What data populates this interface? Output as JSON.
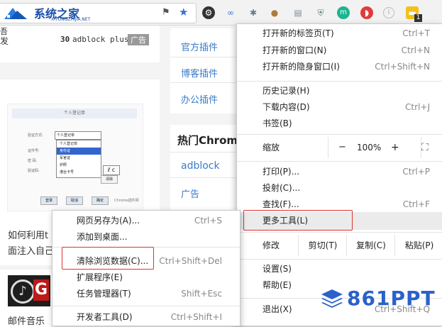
{
  "toolbar": {
    "site_logo_text": "系统之家",
    "site_logo_sub": "XITONGZHIJIA.NET",
    "ext_badge_count": "1"
  },
  "page": {
    "top_left_snippet": "发",
    "top_left_snippet2": "吾",
    "ad_line": {
      "num": "30",
      "name": "adblock plus",
      "tag": "广告"
    },
    "card_caption_1": "如何利用t",
    "card_caption_2": "面注入自己",
    "bottom_caption": "邮件音乐",
    "side_links": [
      "官方插件",
      "博客插件",
      "办公插件"
    ],
    "section_title": "热门Chrom",
    "side_links_2": [
      "adblock",
      "广告"
    ],
    "form_mock": {
      "head": "个人登记单",
      "label1": "验证方式:",
      "select_value": "个人登记单",
      "label2": "证件号:",
      "label3": "密 码:",
      "label4": "验证码:",
      "options": [
        "个人登记单",
        "身份证",
        "军官证",
        "护照",
        "港台卡号"
      ],
      "captcha": "ℓ c",
      "btn_confirm": "确定",
      "btn_clear": "清除",
      "btn_login": "登录",
      "btn_cancel": "取消",
      "footer": "Chrome插件网"
    }
  },
  "main_menu": {
    "items": [
      {
        "label": "打开新的标签页(T)",
        "shortcut": "Ctrl+T"
      },
      {
        "label": "打开新的窗口(N)",
        "shortcut": "Ctrl+N"
      },
      {
        "label": "打开新的隐身窗口(I)",
        "shortcut": "Ctrl+Shift+N"
      },
      {
        "label": "历史记录(H)",
        "shortcut": ""
      },
      {
        "label": "下载内容(D)",
        "shortcut": "Ctrl+J"
      },
      {
        "label": "书签(B)",
        "shortcut": ""
      },
      {
        "label": "打印(P)...",
        "shortcut": "Ctrl+P"
      },
      {
        "label": "投射(C)...",
        "shortcut": ""
      },
      {
        "label": "查找(F)...",
        "shortcut": "Ctrl+F"
      },
      {
        "label": "更多工具(L)",
        "shortcut": ""
      },
      {
        "label": "设置(S)",
        "shortcut": ""
      },
      {
        "label": "帮助(E)",
        "shortcut": ""
      },
      {
        "label": "退出(X)",
        "shortcut": "Ctrl+Shift+Q"
      }
    ],
    "zoom": {
      "label": "缩放",
      "minus": "−",
      "value": "100%",
      "plus": "+"
    },
    "edit": {
      "label": "修改",
      "cut": "剪切(T)",
      "copy": "复制(C)",
      "paste": "粘贴(P)"
    }
  },
  "submenu": {
    "items": [
      {
        "label": "网页另存为(A)...",
        "shortcut": "Ctrl+S"
      },
      {
        "label": "添加到桌面...",
        "shortcut": ""
      },
      {
        "label": "清除浏览数据(C)...",
        "shortcut": "Ctrl+Shift+Del"
      },
      {
        "label": "扩展程序(E)",
        "shortcut": ""
      },
      {
        "label": "任务管理器(T)",
        "shortcut": "Shift+Esc"
      },
      {
        "label": "开发者工具(D)",
        "shortcut": "Ctrl+Shift+I"
      }
    ]
  },
  "watermark": {
    "text": "861PPT"
  },
  "colors": {
    "highlight_border": "#d33333",
    "link_blue": "#3a7bc8",
    "watermark_blue": "#2a62c9"
  }
}
